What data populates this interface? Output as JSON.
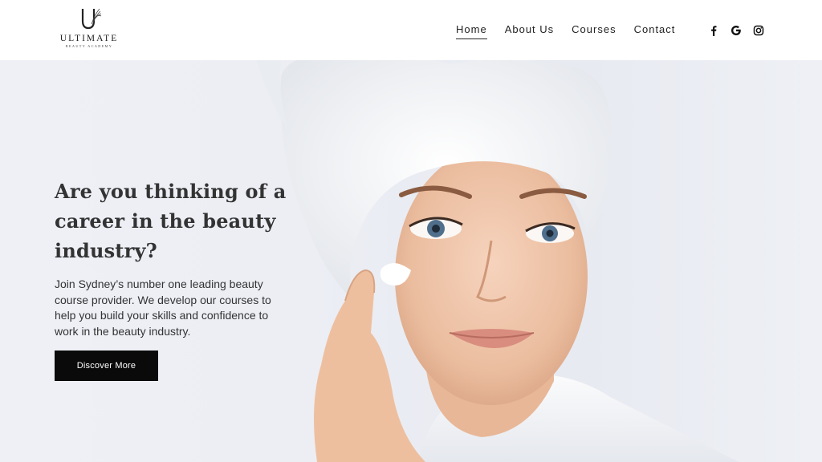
{
  "brand": {
    "name": "ULTIMATE",
    "tagline": "BEAUTY ACADEMY"
  },
  "nav": {
    "items": [
      {
        "label": "Home",
        "active": true
      },
      {
        "label": "About Us",
        "active": false
      },
      {
        "label": "Courses",
        "active": false
      },
      {
        "label": "Contact",
        "active": false
      }
    ]
  },
  "social": {
    "icons": [
      "facebook-icon",
      "google-icon",
      "instagram-icon"
    ]
  },
  "hero": {
    "title": "Are you thinking of a career in the beauty industry?",
    "description": "Join Sydney’s number one leading beauty course provider. We develop our courses to help you build your skills and confidence to work in the beauty industry.",
    "button_label": "Discover More"
  },
  "colors": {
    "button_bg": "#0a0a0a",
    "text_dark": "#333333",
    "hero_bg": "#eceef4"
  }
}
